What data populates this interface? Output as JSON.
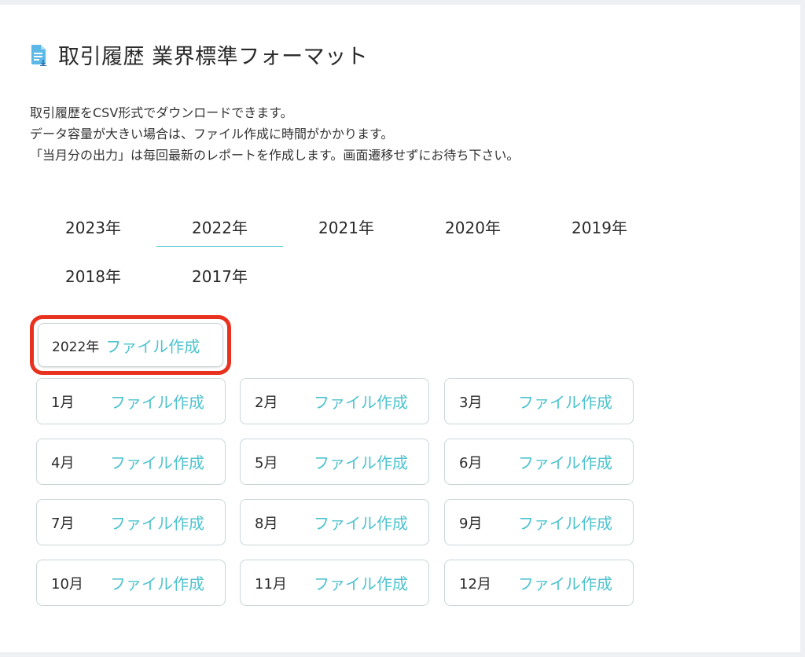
{
  "header": {
    "title": "取引履歴 業界標準フォーマット",
    "icon": "document-download-icon"
  },
  "description": [
    "取引履歴をCSV形式でダウンロードできます。",
    "データ容量が大きい場合は、ファイル作成に時間がかかります。",
    "「当月分の出力」は毎回最新のレポートを作成します。画面遷移せずにお待ち下さい。"
  ],
  "year_tabs": [
    "2023年",
    "2022年",
    "2021年",
    "2020年",
    "2019年",
    "2018年",
    "2017年"
  ],
  "active_year": "2022年",
  "year_button": {
    "label": "2022年",
    "action": "ファイル作成"
  },
  "months": [
    "1月",
    "2月",
    "3月",
    "4月",
    "5月",
    "6月",
    "7月",
    "8月",
    "9月",
    "10月",
    "11月",
    "12月"
  ],
  "month_action": "ファイル作成",
  "colors": {
    "accent": "#4ec3cf",
    "highlight": "#e8321f",
    "border": "#c9d6d8"
  }
}
